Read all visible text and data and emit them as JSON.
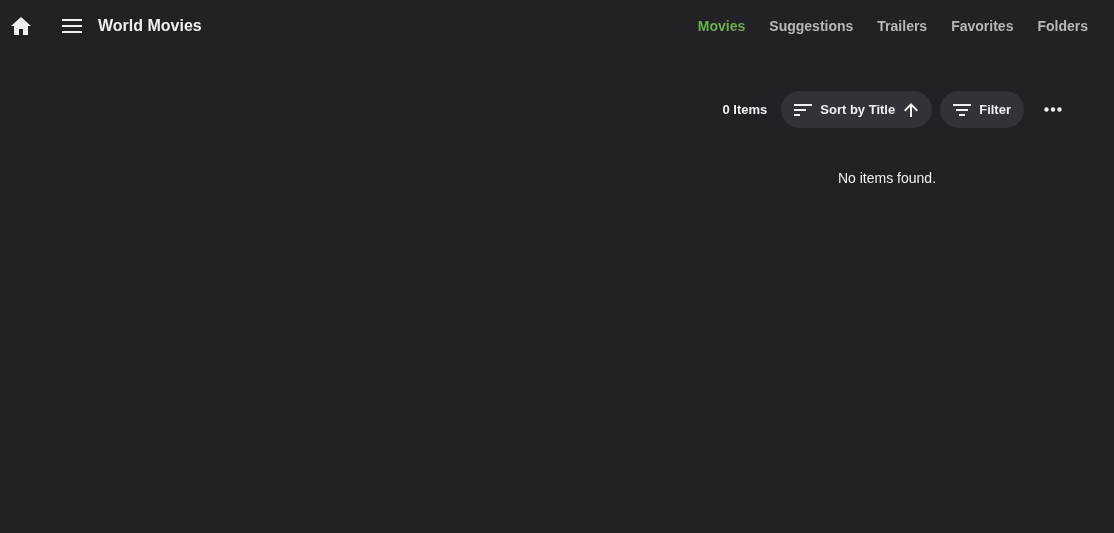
{
  "header": {
    "title": "World Movies"
  },
  "tabs": [
    {
      "label": "Movies",
      "selected": true
    },
    {
      "label": "Suggestions",
      "selected": false
    },
    {
      "label": "Trailers",
      "selected": false
    },
    {
      "label": "Favorites",
      "selected": false
    },
    {
      "label": "Folders",
      "selected": false
    }
  ],
  "toolbar": {
    "item_count": "0 Items",
    "sort": {
      "label": "Sort by Title",
      "ascending": true
    },
    "filter": {
      "label": "Filter"
    }
  },
  "empty_message": "No items found."
}
